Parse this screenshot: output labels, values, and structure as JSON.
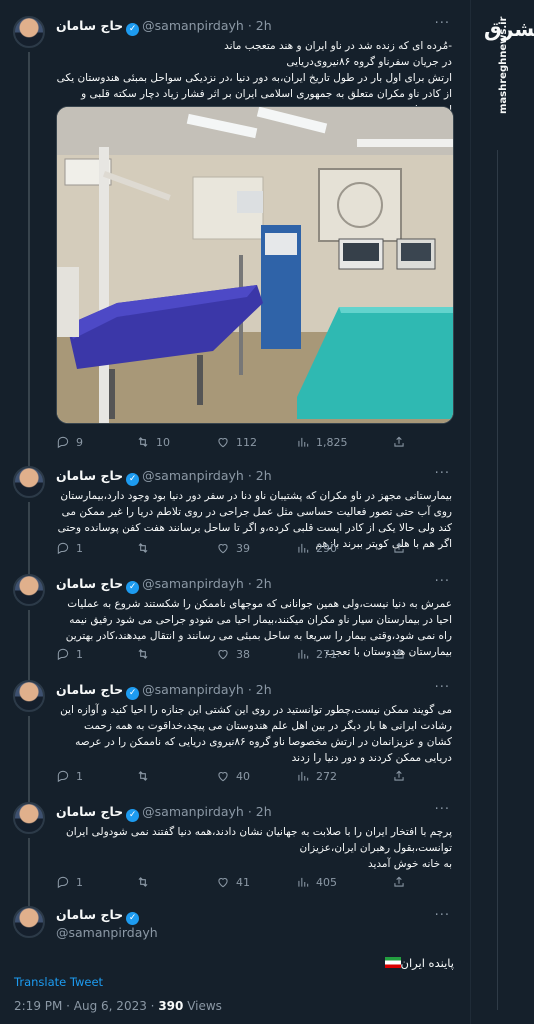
{
  "author": {
    "name": "حاج سامان",
    "handle": "@samanpirdayh",
    "time": "2h"
  },
  "brand": {
    "logo": "مشرق",
    "url": "mashreghnews.ir"
  },
  "tweets": [
    {
      "text": "-مُرده ای که زنده شد در ناو ایران و هند متعجب ماند\nدر جریان سفرناو گروه ۸۶نیروی‌دریایی\nارتش برای اول بار در طول تاریخ ایران،به دور دنیا ،در نزدیکی سواحل بمبئی هندوستان یکی از کادر ناو مکران متعلق به جمهوری اسلامی ایران بر اثر فشار زیاد دچار سکته قلبی و ایست قلبی شد",
      "replies": "9",
      "retweets": "10",
      "likes": "112",
      "views": "1,825"
    },
    {
      "text": "بیمارستانی مجهز در ناو مکران که پشتیبان ناو دنا در سفر دور دنیا بود وجود دارد،بیمارستان روی آب حتی تصور فعالیت حساسی مثل عمل جراحی در روی تلاطم دریا را غیر ممکن می کند ولی حالا یکی از کادر ایست قلبی کرده،و اگر تا ساحل برسانند هفت کفن پوسانده وحتی اگر هم با هلی کوپتر ببرند بازهم",
      "replies": "1",
      "retweets": "",
      "likes": "39",
      "views": "290"
    },
    {
      "text": "عمرش به دنیا نیست،ولی همین جوانانی که موجهای ناممکن را شکستند شروع به عملیات احیا در بیمارستان سیار ناو مکران میکنند،بیمار احیا می شودو جراحی می شود رفیق نیمه راه نمی شود،وقتی بیمار را سریعا به ساحل بمبئی می رسانند و انتقال میدهند،کادر بهترین بیمارستان هندوستان با تعجب",
      "replies": "1",
      "retweets": "",
      "likes": "38",
      "views": "271"
    },
    {
      "text": "می گویند ممکن نیست،چطور توانستید در روی این کشتی این جنازه را احیا کنید و آوازه این رشادت ایرانی ها بار دیگر در بین اهل علم هندوستان می پیچد،خداقوت به همه زحمت کشان و عزیزانمان در ارتش مخصوصا ناو گروه ۸۶نیروی دریایی که ناممکن را در عرصه دریایی ممکن کردند و دور دنیا را زدند",
      "replies": "1",
      "retweets": "",
      "likes": "40",
      "views": "272"
    },
    {
      "text": "پرچم با افتخار ایران را با صلابت به جهانیان نشان دادند،همه دنیا گفتند نمی شودولی ایران توانست،بقول رهبران ایران،عزیزان\nبه خانه خوش آمدید",
      "replies": "1",
      "retweets": "",
      "likes": "41",
      "views": "405"
    }
  ],
  "focus": {
    "text": "پاینده ایران",
    "translate": "Translate Tweet",
    "time": "2:19 PM · Aug 6, 2023 ·",
    "views_count": "390",
    "views_label": "Views"
  }
}
